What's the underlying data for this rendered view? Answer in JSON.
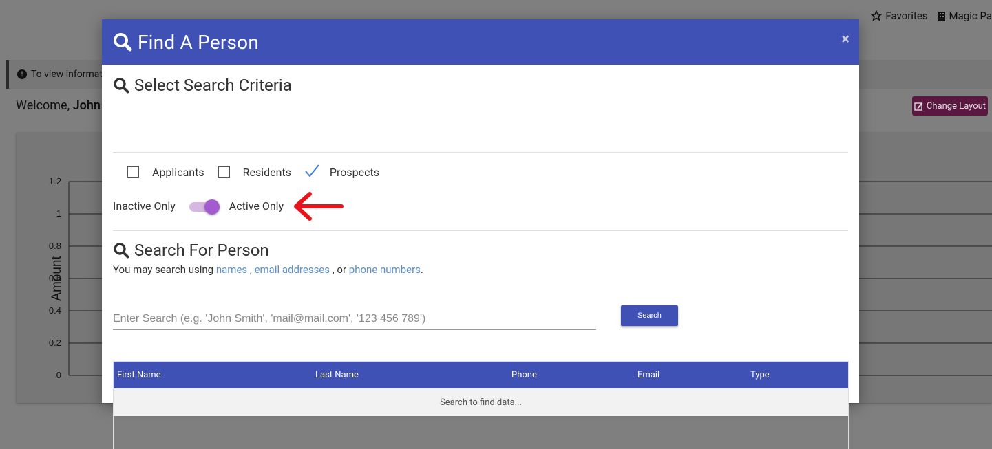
{
  "background": {
    "nav": {
      "favorites": "Favorites",
      "magic": "Magic Pa"
    },
    "info_text": "To view informat",
    "welcome_prefix": "Welcome,",
    "welcome_name": "John",
    "change_layout": "Change Layout",
    "chart_data": {
      "type": "line",
      "ylabel": "Amount",
      "ylim": [
        0,
        1.2
      ],
      "yticks": [
        "1.2",
        "1",
        "0.8",
        "0.6",
        "0.4",
        "0.2",
        "0"
      ],
      "grid": true
    }
  },
  "modal": {
    "title": "Find A Person",
    "close": "×",
    "criteria_title": "Select Search Criteria",
    "checkboxes": [
      {
        "label": "Applicants",
        "checked": false
      },
      {
        "label": "Residents",
        "checked": false
      },
      {
        "label": "Prospects",
        "checked": true
      }
    ],
    "toggle": {
      "left_label": "Inactive Only",
      "right_label": "Active Only",
      "state": "active"
    },
    "search_title": "Search For Person",
    "help": {
      "prefix": "You may search using",
      "names": "names",
      "sep1": ",",
      "emails": "email addresses",
      "sep2": ", or",
      "phones": "phone numbers",
      "end": "."
    },
    "search_placeholder": "Enter Search (e.g. 'John Smith', 'mail@mail.com', '123 456 789')",
    "search_button": "Search",
    "table": {
      "columns": [
        "First Name",
        "Last Name",
        "Phone",
        "Email",
        "Type"
      ],
      "empty_text": "Search to find data..."
    },
    "colors": {
      "header": "#3f51b5",
      "toggle": "#a25ccf",
      "link": "#5b8fc7",
      "annotation_arrow": "#e8141c"
    }
  }
}
